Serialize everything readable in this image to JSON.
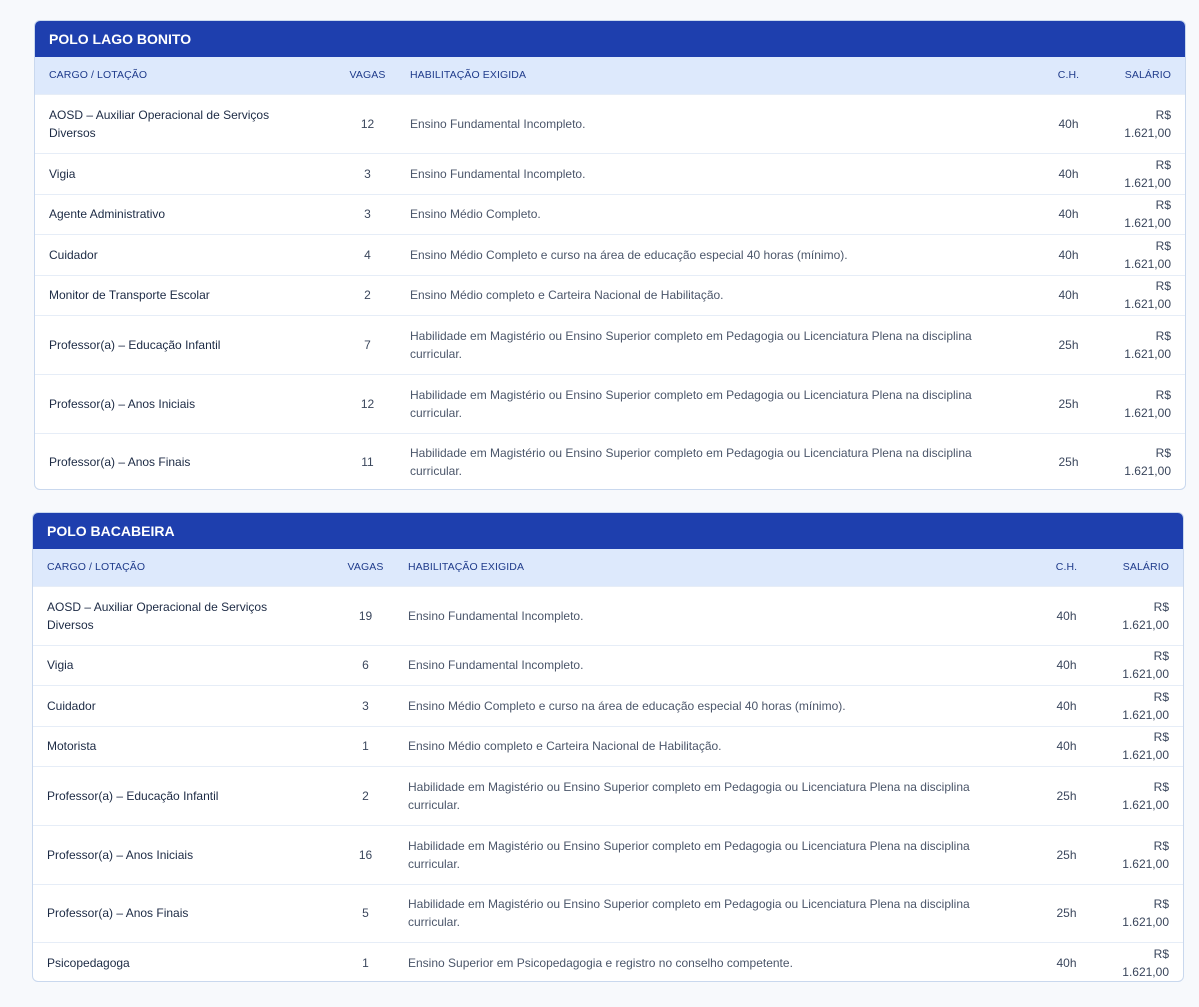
{
  "headers": {
    "cargo": "CARGO / LOTAÇÃO",
    "vagas": "VAGAS",
    "habilitacao": "HABILITAÇÃO EXIGIDA",
    "ch": "C.H.",
    "salario": "SALÁRIO"
  },
  "polos": [
    {
      "title": "POLO LAGO BONITO",
      "rows": [
        {
          "cargo": "AOSD – Auxiliar Operacional de Serviços Diversos",
          "vagas": "12",
          "habilitacao": "Ensino Fundamental Incompleto.",
          "ch": "40h",
          "salario": "R$ 1.621,00"
        },
        {
          "cargo": "Vigia",
          "vagas": "3",
          "habilitacao": "Ensino Fundamental Incompleto.",
          "ch": "40h",
          "salario": "R$ 1.621,00"
        },
        {
          "cargo": "Agente Administrativo",
          "vagas": "3",
          "habilitacao": "Ensino Médio Completo.",
          "ch": "40h",
          "salario": "R$ 1.621,00"
        },
        {
          "cargo": "Cuidador",
          "vagas": "4",
          "habilitacao": "Ensino Médio Completo e curso na área de educação especial 40 horas (mínimo).",
          "ch": "40h",
          "salario": "R$ 1.621,00"
        },
        {
          "cargo": "Monitor de Transporte Escolar",
          "vagas": "2",
          "habilitacao": "Ensino Médio completo e Carteira Nacional de Habilitação.",
          "ch": "40h",
          "salario": "R$ 1.621,00"
        },
        {
          "cargo": "Professor(a) – Educação Infantil",
          "vagas": "7",
          "habilitacao": "Habilidade em Magistério ou Ensino Superior completo em Pedagogia ou Licenciatura Plena na disciplina curricular.",
          "ch": "25h",
          "salario": "R$ 1.621,00"
        },
        {
          "cargo": "Professor(a) – Anos Iniciais",
          "vagas": "12",
          "habilitacao": "Habilidade em Magistério ou Ensino Superior completo em Pedagogia ou Licenciatura Plena na disciplina curricular.",
          "ch": "25h",
          "salario": "R$ 1.621,00"
        },
        {
          "cargo": "Professor(a) – Anos Finais",
          "vagas": "11",
          "habilitacao": "Habilidade em Magistério ou Ensino Superior completo em Pedagogia ou Licenciatura Plena na disciplina curricular.",
          "ch": "25h",
          "salario": "R$ 1.621,00"
        }
      ]
    },
    {
      "title": "POLO BACABEIRA",
      "rows": [
        {
          "cargo": "AOSD – Auxiliar Operacional de Serviços Diversos",
          "vagas": "19",
          "habilitacao": "Ensino Fundamental Incompleto.",
          "ch": "40h",
          "salario": "R$ 1.621,00"
        },
        {
          "cargo": "Vigia",
          "vagas": "6",
          "habilitacao": "Ensino Fundamental Incompleto.",
          "ch": "40h",
          "salario": "R$ 1.621,00"
        },
        {
          "cargo": "Cuidador",
          "vagas": "3",
          "habilitacao": "Ensino Médio Completo e curso na área de educação especial 40 horas (mínimo).",
          "ch": "40h",
          "salario": "R$ 1.621,00"
        },
        {
          "cargo": "Motorista",
          "vagas": "1",
          "habilitacao": "Ensino Médio completo e Carteira Nacional de Habilitação.",
          "ch": "40h",
          "salario": "R$ 1.621,00"
        },
        {
          "cargo": "Professor(a) – Educação Infantil",
          "vagas": "2",
          "habilitacao": "Habilidade em Magistério ou Ensino Superior completo em Pedagogia ou Licenciatura Plena na disciplina curricular.",
          "ch": "25h",
          "salario": "R$ 1.621,00"
        },
        {
          "cargo": "Professor(a) – Anos Iniciais",
          "vagas": "16",
          "habilitacao": "Habilidade em Magistério ou Ensino Superior completo em Pedagogia ou Licenciatura Plena na disciplina curricular.",
          "ch": "25h",
          "salario": "R$ 1.621,00"
        },
        {
          "cargo": "Professor(a) – Anos Finais",
          "vagas": "5",
          "habilitacao": "Habilidade em Magistério ou Ensino Superior completo em Pedagogia ou Licenciatura Plena na disciplina curricular.",
          "ch": "25h",
          "salario": "R$ 1.621,00"
        },
        {
          "cargo": "Psicopedagoga",
          "vagas": "1",
          "habilitacao": "Ensino Superior em Psicopedagogia e registro no conselho competente.",
          "ch": "40h",
          "salario": "R$ 1.621,00"
        }
      ]
    }
  ]
}
